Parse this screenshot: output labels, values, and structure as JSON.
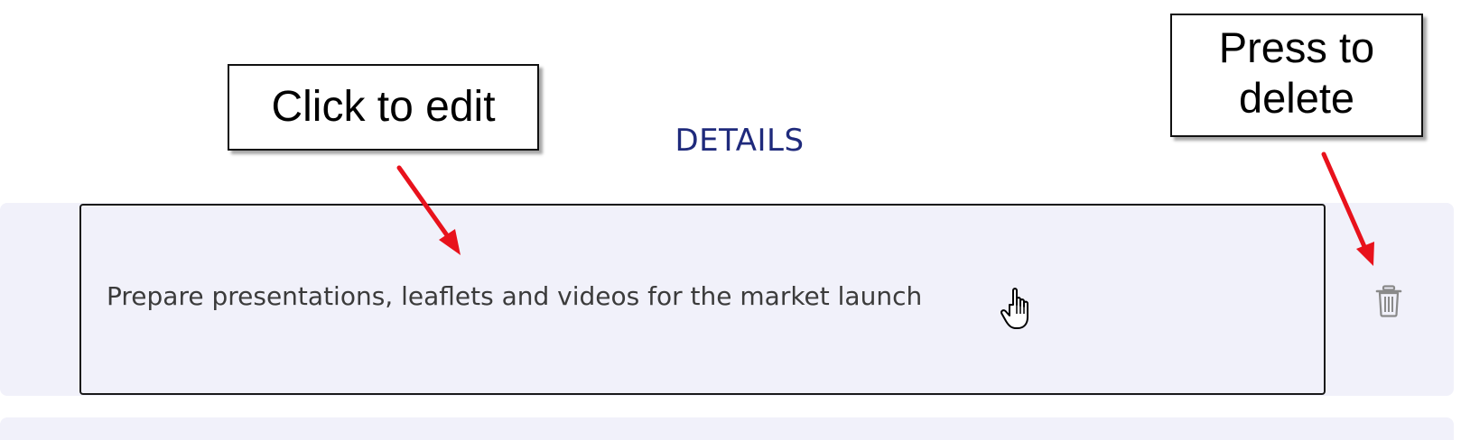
{
  "section": {
    "title": "DETAILS"
  },
  "detail_item": {
    "text": "Prepare presentations, leaflets and videos for the market launch"
  },
  "icons": {
    "delete": "trash-icon",
    "cursor": "hand-pointer-cursor"
  },
  "annotations": {
    "edit_callout": "Click to edit",
    "delete_callout_line1": "Press to",
    "delete_callout_line2": "delete"
  },
  "colors": {
    "title": "#1f2a7c",
    "row_background": "#f1f1fa",
    "arrow": "#e8121c",
    "icon": "#8a8a8a"
  }
}
